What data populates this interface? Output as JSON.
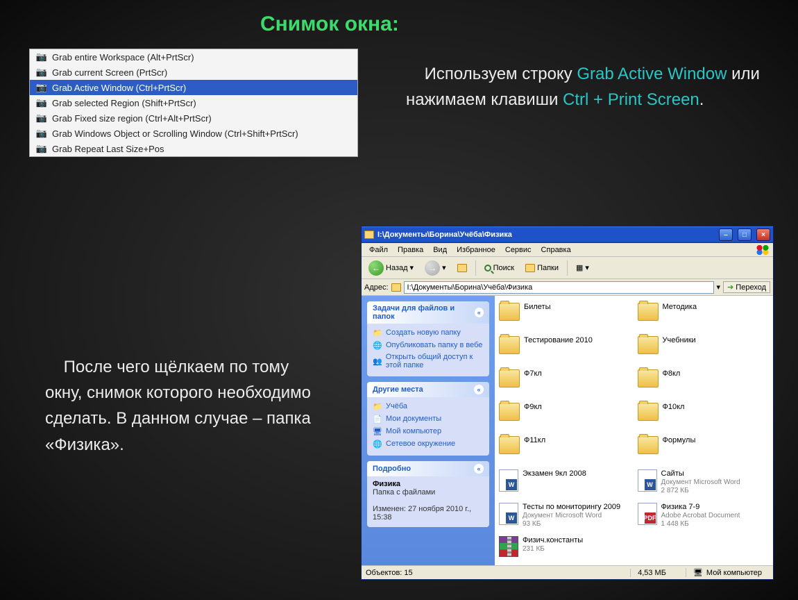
{
  "slide_title": "Снимок окна:",
  "grab_menu": {
    "items": [
      {
        "label": "Grab entire Workspace (Alt+PrtScr)",
        "selected": false
      },
      {
        "label": "Grab current Screen (PrtScr)",
        "selected": false
      },
      {
        "label": "Grab Active Window (Ctrl+PrtScr)",
        "selected": true
      },
      {
        "label": "Grab selected Region (Shift+PrtScr)",
        "selected": false
      },
      {
        "label": "Grab Fixed size region (Ctrl+Alt+PrtScr)",
        "selected": false
      },
      {
        "label": "Grab Windows Object or Scrolling Window (Ctrl+Shift+PrtScr)",
        "selected": false
      },
      {
        "label": "Grab Repeat Last Size+Pos",
        "selected": false
      }
    ]
  },
  "para_right": {
    "pre": "Используем строку ",
    "hl1": "Grab Active Window",
    "mid": " или нажимаем клавиши ",
    "hl2": "Ctrl + Print Screen",
    "post": "."
  },
  "para_left": "После чего щёлкаем по тому окну, снимок которого необходимо сделать. В данном случае – папка «Физика».",
  "explorer": {
    "title": "I:\\Документы\\Борина\\Учёба\\Физика",
    "menubar": [
      "Файл",
      "Правка",
      "Вид",
      "Избранное",
      "Сервис",
      "Справка"
    ],
    "toolbar": {
      "back": "Назад",
      "search": "Поиск",
      "folders": "Папки"
    },
    "addressbar": {
      "label": "Адрес:",
      "value": "I:\\Документы\\Борина\\Учёба\\Физика",
      "go": "Переход"
    },
    "panels": {
      "tasks": {
        "title": "Задачи для файлов и папок",
        "items": [
          "Создать новую папку",
          "Опубликовать папку в вебе",
          "Открыть общий доступ к этой папке"
        ]
      },
      "places": {
        "title": "Другие места",
        "items": [
          "Учёба",
          "Мои документы",
          "Мой компьютер",
          "Сетевое окружение"
        ]
      },
      "details": {
        "title": "Подробно",
        "name": "Физика",
        "kind": "Папка с файлами",
        "changed_label": "Изменен:",
        "changed": "27 ноября 2010 г., 15:38"
      }
    },
    "files": [
      {
        "type": "folder",
        "name": "Билеты"
      },
      {
        "type": "folder",
        "name": "Методика"
      },
      {
        "type": "folder",
        "name": "Тестирование 2010"
      },
      {
        "type": "folder",
        "name": "Учебники"
      },
      {
        "type": "folder",
        "name": "Ф7кл"
      },
      {
        "type": "folder",
        "name": "Ф8кл"
      },
      {
        "type": "folder",
        "name": "Ф9кл"
      },
      {
        "type": "folder",
        "name": "Ф10кл"
      },
      {
        "type": "folder",
        "name": "Ф11кл"
      },
      {
        "type": "folder",
        "name": "Формулы"
      },
      {
        "type": "word",
        "name": "Экзамен 9кл 2008"
      },
      {
        "type": "word",
        "name": "Сайты",
        "kind": "Документ Microsoft Word",
        "size": "2 872 КБ"
      },
      {
        "type": "word",
        "name": "Тесты по мониторингу 2009",
        "kind": "Документ Microsoft Word",
        "size": "93 КБ"
      },
      {
        "type": "pdf",
        "name": "Физика 7-9",
        "kind": "Adobe Acrobat Document",
        "size": "1 448 КБ"
      },
      {
        "type": "rar",
        "name": "Физич.константы",
        "size": "231 КБ"
      }
    ],
    "status": {
      "objects_label": "Объектов:",
      "objects": "15",
      "size": "4,53 МБ",
      "location": "Мой компьютер"
    }
  }
}
